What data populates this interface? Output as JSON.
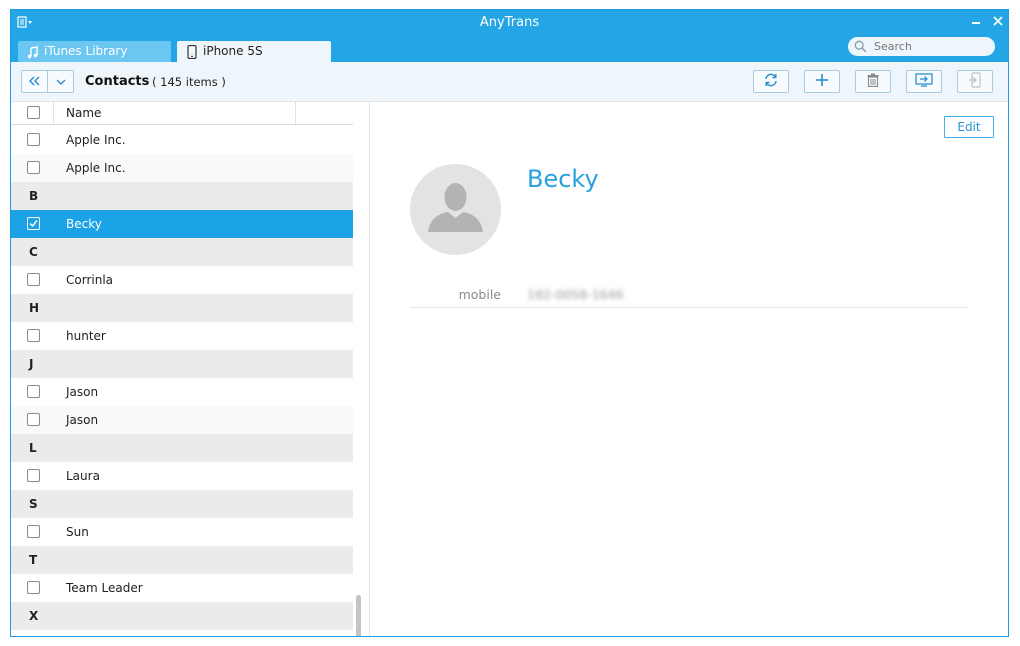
{
  "app": {
    "title": "AnyTrans"
  },
  "tabs": [
    {
      "label": "iTunes Library",
      "icon": "music-note-icon"
    },
    {
      "label": "iPhone 5S",
      "icon": "iphone-icon"
    }
  ],
  "search": {
    "placeholder": "Search"
  },
  "toolbar": {
    "section_title": "Contacts",
    "count": "( 145 items )",
    "buttons": [
      "refresh-icon",
      "add-icon",
      "delete-icon",
      "to-computer-icon",
      "to-device-icon"
    ]
  },
  "list": {
    "column_name": "Name",
    "rows": [
      {
        "type": "contact",
        "label": "Apple Inc.",
        "checked": false
      },
      {
        "type": "contact",
        "label": "Apple Inc.",
        "checked": false
      },
      {
        "type": "section",
        "label": "B"
      },
      {
        "type": "contact",
        "label": "Becky",
        "checked": true,
        "selected": true
      },
      {
        "type": "section",
        "label": "C"
      },
      {
        "type": "contact",
        "label": "Corrinla",
        "checked": false
      },
      {
        "type": "section",
        "label": "H"
      },
      {
        "type": "contact",
        "label": "hunter",
        "checked": false
      },
      {
        "type": "section",
        "label": "J"
      },
      {
        "type": "contact",
        "label": "Jason",
        "checked": false
      },
      {
        "type": "contact",
        "label": "Jason",
        "checked": false
      },
      {
        "type": "section",
        "label": "L"
      },
      {
        "type": "contact",
        "label": "Laura",
        "checked": false
      },
      {
        "type": "section",
        "label": "S"
      },
      {
        "type": "contact",
        "label": "Sun",
        "checked": false
      },
      {
        "type": "section",
        "label": "T"
      },
      {
        "type": "contact",
        "label": "Team Leader",
        "checked": false
      },
      {
        "type": "section",
        "label": "X"
      }
    ]
  },
  "detail": {
    "edit_label": "Edit",
    "name": "Becky",
    "field_label": "mobile",
    "field_value": "182-0058-1646"
  },
  "colors": {
    "accent": "#24a6e6",
    "selected_row": "#1ca2e6",
    "name_text": "#27a1df"
  }
}
